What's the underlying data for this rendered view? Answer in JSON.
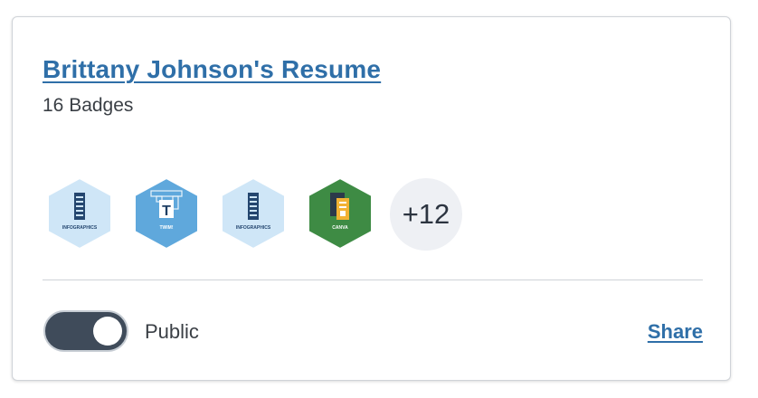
{
  "card": {
    "title": "Brittany Johnson's Resume",
    "badge_count": "16 Badges",
    "badges": [
      {
        "label": "INFOGRAPHICS",
        "color": "#cfe6f7",
        "icon": "infographics-icon"
      },
      {
        "label": "TWIM!",
        "color": "#5fa8dc",
        "icon": "twim-icon"
      },
      {
        "label": "INFOGRAPHICS",
        "color": "#cfe6f7",
        "icon": "infographics-icon"
      },
      {
        "label": "CANVA",
        "color": "#3e8b44",
        "icon": "canva-icon"
      }
    ],
    "more_badges": "+12",
    "visibility_label": "Public",
    "visibility_on": true,
    "share_label": "Share"
  },
  "colors": {
    "link": "#2f6fa8",
    "toggle_track": "#3f4b5a"
  }
}
